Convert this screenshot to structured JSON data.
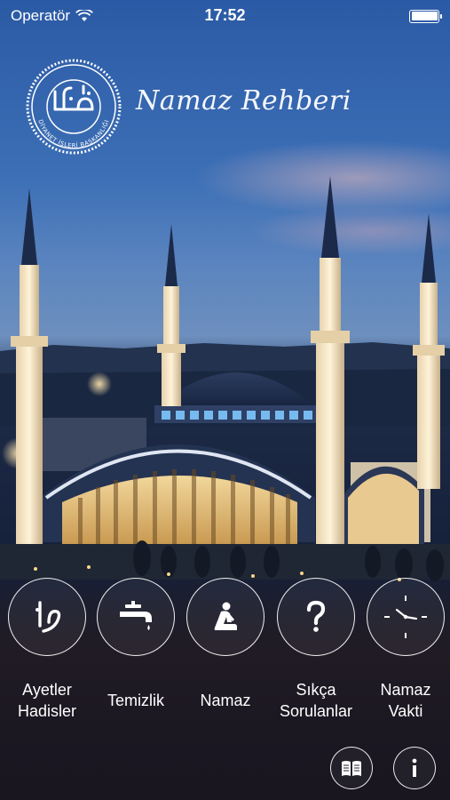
{
  "status_bar": {
    "carrier": "Operatör",
    "time": "17:52"
  },
  "header": {
    "title": "Namaz Rehberi",
    "logo_text": "DİYANET İŞLERİ BAŞKANLIĞI"
  },
  "menu": {
    "items": [
      {
        "label": "Ayetler\nHadisler",
        "icon": "arabic-calligraphy-icon"
      },
      {
        "label": "Temizlik",
        "icon": "water-tap-icon"
      },
      {
        "label": "Namaz",
        "icon": "praying-person-icon"
      },
      {
        "label": "Sıkça\nSorulanlar",
        "icon": "question-mark-icon"
      },
      {
        "label": "Namaz\nVakti",
        "icon": "clock-icon"
      }
    ]
  },
  "bottom_bar": {
    "left_icon": "book-icon",
    "right_icon": "info-icon"
  },
  "colors": {
    "sky_top": "#2b5aa5",
    "sky_mid": "#6d8fbe",
    "ground": "#15203a",
    "accent_text": "#ffffff"
  }
}
